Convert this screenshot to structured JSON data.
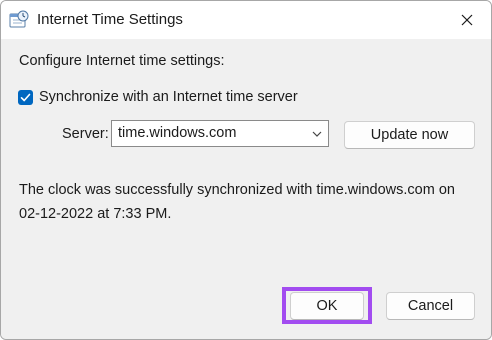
{
  "window": {
    "title": "Internet Time Settings",
    "title_icon": "clock-calendar-icon",
    "close_icon": "close-icon"
  },
  "heading": "Configure Internet time settings:",
  "sync": {
    "checked": true,
    "label": "Synchronize with an Internet time server"
  },
  "server": {
    "label": "Server:",
    "value": "time.windows.com",
    "arrow_icon": "chevron-down-icon"
  },
  "buttons": {
    "update_now": "Update now",
    "ok": "OK",
    "cancel": "Cancel"
  },
  "status": {
    "line1": "The clock was successfully synchronized with time.windows.com on",
    "line2": "02-12-2022 at 7:33 PM."
  },
  "colors": {
    "accent": "#0067c0",
    "highlight": "#a24cf0"
  }
}
